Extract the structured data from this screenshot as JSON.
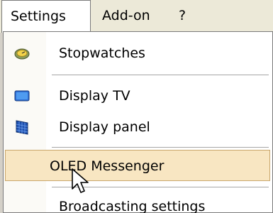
{
  "menubar": {
    "items": [
      {
        "label": "Settings",
        "active": true
      },
      {
        "label": "Add-on",
        "active": false
      },
      {
        "label": "?",
        "active": false
      }
    ]
  },
  "menu": {
    "items": [
      {
        "label": "Stopwatches",
        "icon": "stopwatch-icon"
      },
      {
        "label": "Display TV",
        "icon": "monitor-icon"
      },
      {
        "label": "Display panel",
        "icon": "led-panel-icon"
      },
      {
        "label": "OLED Messenger",
        "icon": "",
        "highlighted": true
      },
      {
        "label": "Broadcasting settings",
        "icon": ""
      }
    ]
  },
  "colors": {
    "highlight_bg": "#f8e6c2",
    "highlight_border": "#c9a66b",
    "menubar_bg": "#ece9d8"
  }
}
